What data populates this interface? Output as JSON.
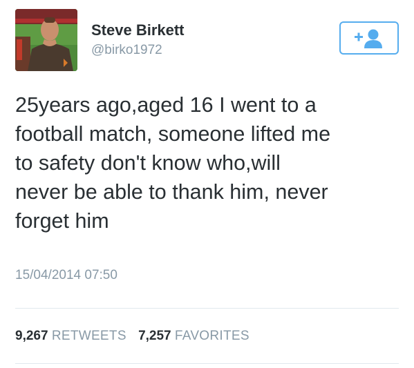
{
  "author": {
    "name": "Steve Birkett",
    "handle": "@birko1972",
    "avatar_icon": "profile-photo"
  },
  "follow_button": {
    "icon": "follow-user-plus-icon",
    "color": "#55acee"
  },
  "tweet": {
    "lines": [
      "25years ago,aged 16 I went to a",
      "football match, someone lifted me",
      "to safety don't know who,will",
      "never be able to thank him, never",
      "forget him"
    ],
    "timestamp": "15/04/2014 07:50"
  },
  "stats": {
    "retweets": {
      "count": "9,267",
      "label": "RETWEETS"
    },
    "favorites": {
      "count": "7,257",
      "label": "FAVORITES"
    }
  },
  "colors": {
    "text": "#292f33",
    "muted": "#8899a6",
    "accent": "#55acee",
    "divider": "#e1e8ed"
  }
}
